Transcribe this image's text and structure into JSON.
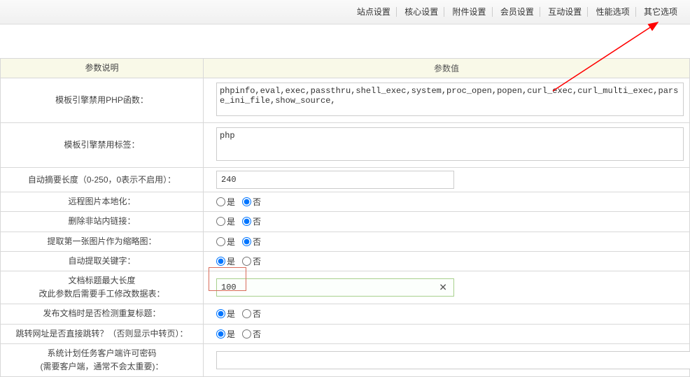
{
  "topnav": {
    "items": [
      "站点设置",
      "核心设置",
      "附件设置",
      "会员设置",
      "互动设置",
      "性能选项",
      "其它选项"
    ]
  },
  "headers": {
    "param_desc": "参数说明",
    "param_value": "参数值"
  },
  "rows": {
    "disable_php_funcs": {
      "label": "模板引擎禁用PHP函数：",
      "value": "phpinfo,eval,exec,passthru,shell_exec,system,proc_open,popen,curl_exec,curl_multi_exec,parse_ini_file,show_source,"
    },
    "disable_tags": {
      "label": "模板引擎禁用标签：",
      "value": "php"
    },
    "auto_summary": {
      "label": "自动摘要长度（0-250，0表示不启用）：",
      "value": "240"
    },
    "remote_img": {
      "label": "远程图片本地化：",
      "yes": "是",
      "no": "否",
      "selected": "no"
    },
    "remove_external": {
      "label": "删除非站内链接：",
      "yes": "是",
      "no": "否",
      "selected": "no"
    },
    "first_img_thumb": {
      "label": "提取第一张图片作为缩略图：",
      "yes": "是",
      "no": "否",
      "selected": "no"
    },
    "auto_keywords": {
      "label": "自动提取关键字：",
      "yes": "是",
      "no": "否",
      "selected": "yes"
    },
    "title_maxlen": {
      "label_line1": "文档标题最大长度",
      "label_line2": "改此参数后需要手工修改数据表：",
      "value": "100"
    },
    "check_dup_title": {
      "label": "发布文档时是否检测重复标题：",
      "yes": "是",
      "no": "否",
      "selected": "yes"
    },
    "jump_direct": {
      "label": "跳转网址是否直接跳转？（否则显示中转页）：",
      "yes": "是",
      "no": "否",
      "selected": "yes"
    },
    "cron_password": {
      "label_line1": "系统计划任务客户端许可密码",
      "label_line2": "(需要客户端，通常不会太重要)："
    }
  }
}
